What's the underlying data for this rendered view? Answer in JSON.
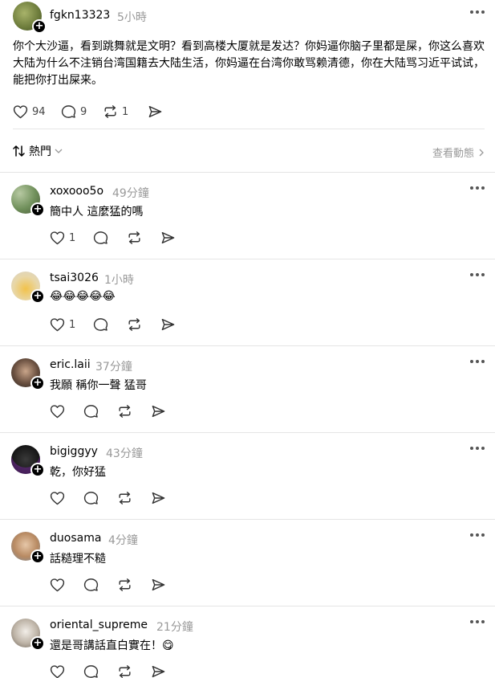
{
  "post": {
    "username": "fgkn13323",
    "time": "5小時",
    "text": "你个大沙逼，看到跳舞就是文明？看到高楼大厦就是发达？你妈逼你脑子里都是屎，你这么喜欢大陆为什么不注销台湾国籍去大陆生活，你妈逼在台湾你敢骂赖清德，你在大陆骂习近平试试，能把你打出屎来。",
    "likes": "94",
    "comments": "9",
    "reposts": "1"
  },
  "sort": {
    "label": "熱門"
  },
  "activity": {
    "label": "查看動態"
  },
  "replies": [
    {
      "username": "xoxooo5o",
      "time": "49分鐘",
      "text": "簡中人 這麼猛的嗎",
      "likes": "1"
    },
    {
      "username": "tsai3026",
      "time": "1小時",
      "text": "😂😂😂😂😂",
      "likes": "1"
    },
    {
      "username": "eric.laii",
      "time": "37分鐘",
      "text": "我願 稱你一聲 猛哥",
      "likes": ""
    },
    {
      "username": "bigiggyy",
      "time": "43分鐘",
      "text": "乾，你好猛",
      "likes": ""
    },
    {
      "username": "duosama",
      "time": "4分鐘",
      "text": "話糙理不糙",
      "likes": ""
    },
    {
      "username": "oriental_supreme",
      "time": "21分鐘",
      "text": "還是哥講話直白實在！😋",
      "likes": ""
    }
  ],
  "colors": {
    "text": "#000000",
    "muted": "#999999",
    "divider": "#e5e5e5",
    "emoji": "#f7c53e"
  }
}
